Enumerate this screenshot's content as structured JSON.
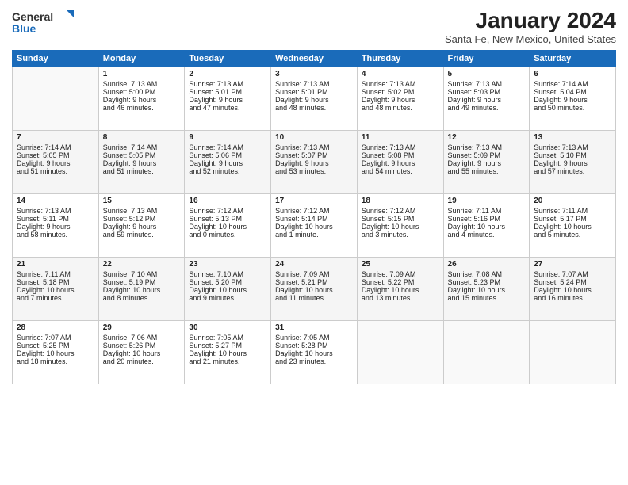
{
  "logo": {
    "general": "General",
    "blue": "Blue"
  },
  "title": "January 2024",
  "subtitle": "Santa Fe, New Mexico, United States",
  "days": [
    "Sunday",
    "Monday",
    "Tuesday",
    "Wednesday",
    "Thursday",
    "Friday",
    "Saturday"
  ],
  "weeks": [
    [
      {
        "day": "",
        "content": ""
      },
      {
        "day": "1",
        "content": "Sunrise: 7:13 AM\nSunset: 5:00 PM\nDaylight: 9 hours\nand 46 minutes."
      },
      {
        "day": "2",
        "content": "Sunrise: 7:13 AM\nSunset: 5:01 PM\nDaylight: 9 hours\nand 47 minutes."
      },
      {
        "day": "3",
        "content": "Sunrise: 7:13 AM\nSunset: 5:01 PM\nDaylight: 9 hours\nand 48 minutes."
      },
      {
        "day": "4",
        "content": "Sunrise: 7:13 AM\nSunset: 5:02 PM\nDaylight: 9 hours\nand 48 minutes."
      },
      {
        "day": "5",
        "content": "Sunrise: 7:13 AM\nSunset: 5:03 PM\nDaylight: 9 hours\nand 49 minutes."
      },
      {
        "day": "6",
        "content": "Sunrise: 7:14 AM\nSunset: 5:04 PM\nDaylight: 9 hours\nand 50 minutes."
      }
    ],
    [
      {
        "day": "7",
        "content": "Sunrise: 7:14 AM\nSunset: 5:05 PM\nDaylight: 9 hours\nand 51 minutes."
      },
      {
        "day": "8",
        "content": "Sunrise: 7:14 AM\nSunset: 5:05 PM\nDaylight: 9 hours\nand 51 minutes."
      },
      {
        "day": "9",
        "content": "Sunrise: 7:14 AM\nSunset: 5:06 PM\nDaylight: 9 hours\nand 52 minutes."
      },
      {
        "day": "10",
        "content": "Sunrise: 7:13 AM\nSunset: 5:07 PM\nDaylight: 9 hours\nand 53 minutes."
      },
      {
        "day": "11",
        "content": "Sunrise: 7:13 AM\nSunset: 5:08 PM\nDaylight: 9 hours\nand 54 minutes."
      },
      {
        "day": "12",
        "content": "Sunrise: 7:13 AM\nSunset: 5:09 PM\nDaylight: 9 hours\nand 55 minutes."
      },
      {
        "day": "13",
        "content": "Sunrise: 7:13 AM\nSunset: 5:10 PM\nDaylight: 9 hours\nand 57 minutes."
      }
    ],
    [
      {
        "day": "14",
        "content": "Sunrise: 7:13 AM\nSunset: 5:11 PM\nDaylight: 9 hours\nand 58 minutes."
      },
      {
        "day": "15",
        "content": "Sunrise: 7:13 AM\nSunset: 5:12 PM\nDaylight: 9 hours\nand 59 minutes."
      },
      {
        "day": "16",
        "content": "Sunrise: 7:12 AM\nSunset: 5:13 PM\nDaylight: 10 hours\nand 0 minutes."
      },
      {
        "day": "17",
        "content": "Sunrise: 7:12 AM\nSunset: 5:14 PM\nDaylight: 10 hours\nand 1 minute."
      },
      {
        "day": "18",
        "content": "Sunrise: 7:12 AM\nSunset: 5:15 PM\nDaylight: 10 hours\nand 3 minutes."
      },
      {
        "day": "19",
        "content": "Sunrise: 7:11 AM\nSunset: 5:16 PM\nDaylight: 10 hours\nand 4 minutes."
      },
      {
        "day": "20",
        "content": "Sunrise: 7:11 AM\nSunset: 5:17 PM\nDaylight: 10 hours\nand 5 minutes."
      }
    ],
    [
      {
        "day": "21",
        "content": "Sunrise: 7:11 AM\nSunset: 5:18 PM\nDaylight: 10 hours\nand 7 minutes."
      },
      {
        "day": "22",
        "content": "Sunrise: 7:10 AM\nSunset: 5:19 PM\nDaylight: 10 hours\nand 8 minutes."
      },
      {
        "day": "23",
        "content": "Sunrise: 7:10 AM\nSunset: 5:20 PM\nDaylight: 10 hours\nand 9 minutes."
      },
      {
        "day": "24",
        "content": "Sunrise: 7:09 AM\nSunset: 5:21 PM\nDaylight: 10 hours\nand 11 minutes."
      },
      {
        "day": "25",
        "content": "Sunrise: 7:09 AM\nSunset: 5:22 PM\nDaylight: 10 hours\nand 13 minutes."
      },
      {
        "day": "26",
        "content": "Sunrise: 7:08 AM\nSunset: 5:23 PM\nDaylight: 10 hours\nand 15 minutes."
      },
      {
        "day": "27",
        "content": "Sunrise: 7:07 AM\nSunset: 5:24 PM\nDaylight: 10 hours\nand 16 minutes."
      }
    ],
    [
      {
        "day": "28",
        "content": "Sunrise: 7:07 AM\nSunset: 5:25 PM\nDaylight: 10 hours\nand 18 minutes."
      },
      {
        "day": "29",
        "content": "Sunrise: 7:06 AM\nSunset: 5:26 PM\nDaylight: 10 hours\nand 20 minutes."
      },
      {
        "day": "30",
        "content": "Sunrise: 7:05 AM\nSunset: 5:27 PM\nDaylight: 10 hours\nand 21 minutes."
      },
      {
        "day": "31",
        "content": "Sunrise: 7:05 AM\nSunset: 5:28 PM\nDaylight: 10 hours\nand 23 minutes."
      },
      {
        "day": "",
        "content": ""
      },
      {
        "day": "",
        "content": ""
      },
      {
        "day": "",
        "content": ""
      }
    ]
  ]
}
